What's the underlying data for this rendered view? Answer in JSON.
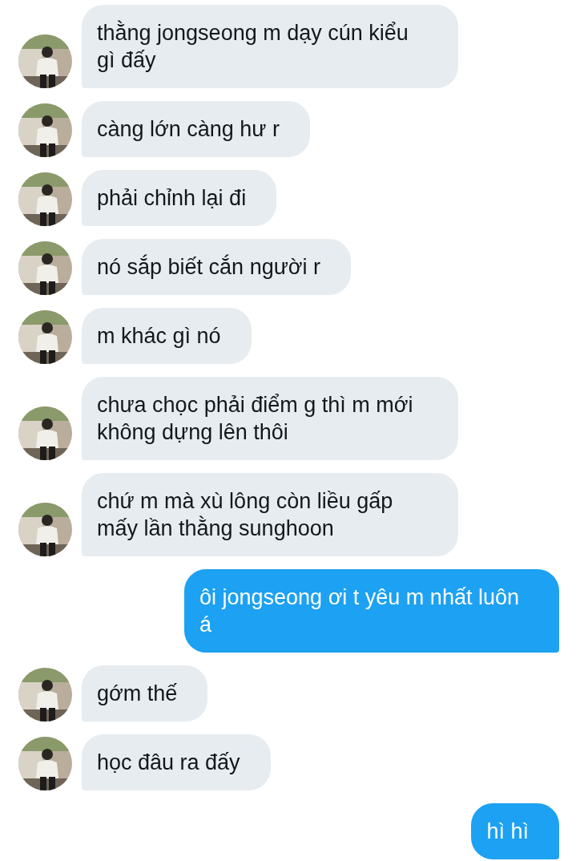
{
  "messages": [
    {
      "kind": "received",
      "text": "thằng jongseong m dạy cún kiểu gì đấy"
    },
    {
      "kind": "received",
      "text": "càng lớn càng hư r"
    },
    {
      "kind": "received",
      "text": "phải chỉnh lại đi"
    },
    {
      "kind": "received",
      "text": "nó sắp biết cắn người r"
    },
    {
      "kind": "received",
      "text": "m khác gì nó"
    },
    {
      "kind": "received",
      "text": "chưa chọc phải điểm g thì m mới không dựng lên thôi"
    },
    {
      "kind": "received",
      "text": "chứ m mà xù lông còn liều gấp mấy lần thằng sunghoon"
    },
    {
      "kind": "sent",
      "text": "ôi jongseong ơi t yêu m nhất luôn á"
    },
    {
      "kind": "received",
      "text": "gớm thế"
    },
    {
      "kind": "received",
      "text": "học đâu ra đấy"
    },
    {
      "kind": "sent",
      "text": "hì hì"
    }
  ]
}
